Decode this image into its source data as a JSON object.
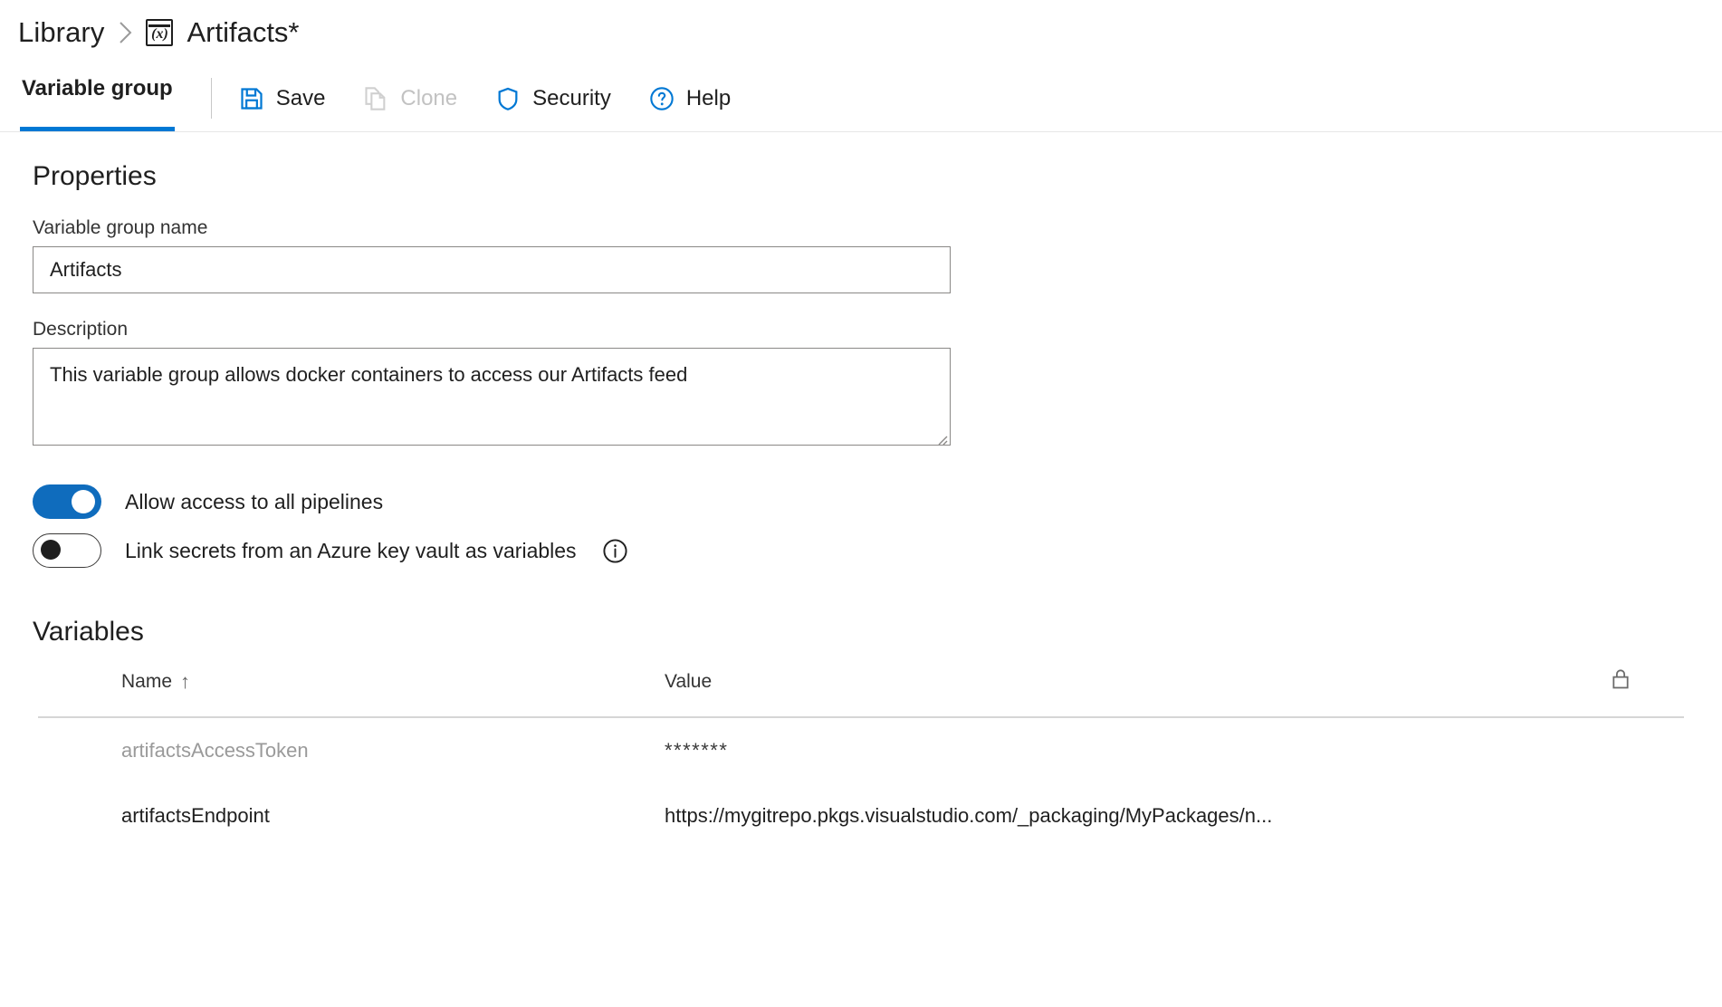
{
  "breadcrumb": {
    "root_label": "Library",
    "separator_icon": "chevron-right-icon",
    "group_icon": "variable-group-icon",
    "group_icon_glyph": "(x)",
    "current_label": "Artifacts*"
  },
  "toolbar": {
    "tab_label": "Variable group",
    "save_label": "Save",
    "clone_label": "Clone",
    "security_label": "Security",
    "help_label": "Help",
    "accent_color": "#0078d4",
    "disabled_color": "#c2c2c2"
  },
  "properties": {
    "heading": "Properties",
    "name_label": "Variable group name",
    "name_value": "Artifacts",
    "name_placeholder": "",
    "description_label": "Description",
    "description_value": "This variable group allows docker containers to access our Artifacts feed",
    "description_placeholder": "",
    "toggles": [
      {
        "label": "Allow access to all pipelines",
        "state": "on"
      },
      {
        "label": "Link secrets from an Azure key vault as variables",
        "state": "off",
        "info_icon": "info-icon"
      }
    ]
  },
  "variables": {
    "heading": "Variables",
    "columns": {
      "name": "Name",
      "sort_arrow": "↑",
      "value": "Value",
      "lock": "lock-icon"
    },
    "rows": [
      {
        "name": "artifactsAccessToken",
        "value": "*******",
        "secret": true
      },
      {
        "name": "artifactsEndpoint",
        "value": "https://mygitrepo.pkgs.visualstudio.com/_packaging/MyPackages/n...",
        "secret": false
      }
    ]
  }
}
